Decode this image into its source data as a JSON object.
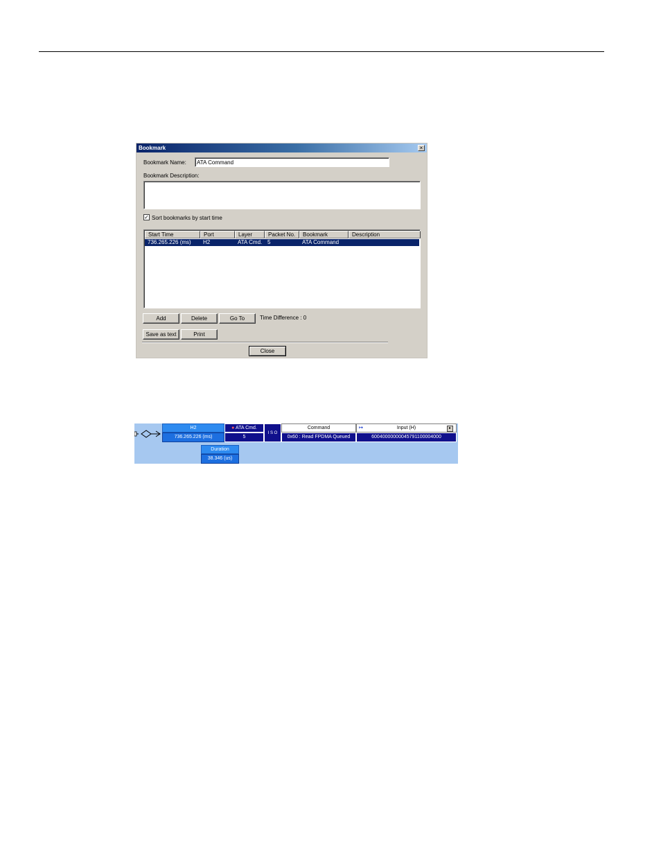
{
  "dialog": {
    "title": "Bookmark",
    "close_glyph": "×",
    "name_label": "Bookmark Name:",
    "name_value": "ATA Command",
    "description_label": "Bookmark Description:",
    "description_value": "",
    "sort_label": "Sort bookmarks by start time",
    "sort_checked_glyph": "✓",
    "columns": [
      "Start Time",
      "Port",
      "Layer",
      "Packet No.",
      "Bookmark",
      "Description"
    ],
    "rows": [
      [
        "736.265.226 (ms)",
        "H2",
        "ATA Cmd.",
        "5",
        "ATA Command",
        ""
      ]
    ],
    "buttons": {
      "add": "Add",
      "delete": "Delete",
      "goto": "Go To",
      "save_text": "Save as text",
      "print": "Print",
      "close": "Close"
    },
    "time_difference": "Time Difference : 0"
  },
  "trace": {
    "port_header": "H2",
    "port_time": "736.265.226 (ms)",
    "layer_header": "ATA Cmd.",
    "packet_no": "5",
    "iso_label": "I S O",
    "command_header": "Command",
    "command_value": "0x60 : Read FPDMA Queued",
    "input_header": "Input (H)",
    "input_value": "60040000000045791100004000",
    "duration_header": "Duration",
    "duration_value": "38.346 (us)"
  }
}
